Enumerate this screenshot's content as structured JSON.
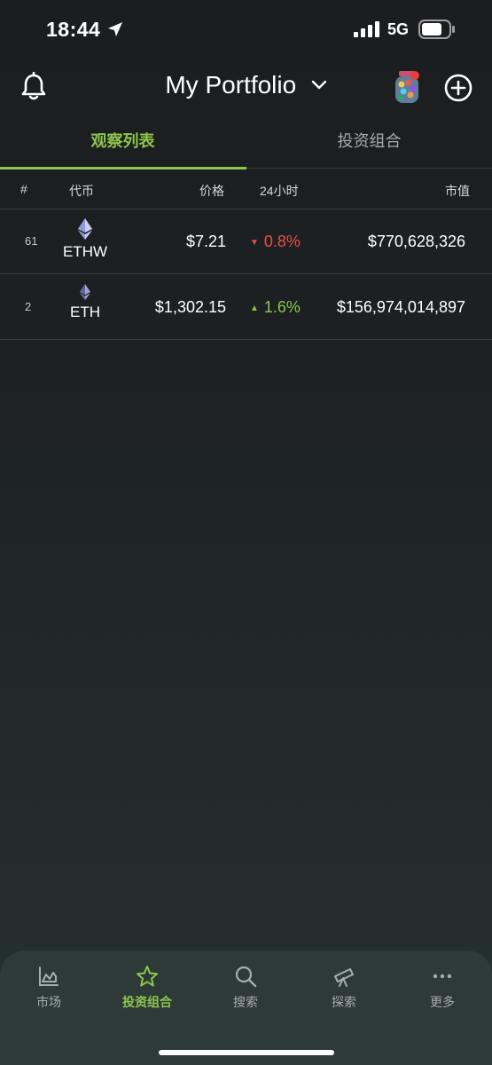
{
  "status_bar": {
    "time": "18:44",
    "network": "5G"
  },
  "header": {
    "title": "My Portfolio"
  },
  "tabs": [
    {
      "label": "观察列表",
      "active": true
    },
    {
      "label": "投资组合",
      "active": false
    }
  ],
  "columns": {
    "rank": "#",
    "coin": "代币",
    "price": "价格",
    "change": "24小时",
    "market_cap": "市值"
  },
  "rows": [
    {
      "rank": "61",
      "symbol": "ETHW",
      "price": "$7.21",
      "change": "0.8%",
      "direction": "down",
      "market_cap": "$770,628,326"
    },
    {
      "rank": "2",
      "symbol": "ETH",
      "price": "$1,302.15",
      "change": "1.6%",
      "direction": "up",
      "market_cap": "$156,974,014,897"
    }
  ],
  "tab_bar": [
    {
      "label": "市场",
      "icon": "chart-icon",
      "active": false
    },
    {
      "label": "投资组合",
      "icon": "star-icon",
      "active": true
    },
    {
      "label": "搜索",
      "icon": "search-icon",
      "active": false
    },
    {
      "label": "探索",
      "icon": "telescope-icon",
      "active": false
    },
    {
      "label": "更多",
      "icon": "more-icon",
      "active": false
    }
  ],
  "colors": {
    "accent": "#8dc64d",
    "negative": "#ea4f45",
    "positive": "#8dc64d",
    "background": "#1b1d1f"
  }
}
